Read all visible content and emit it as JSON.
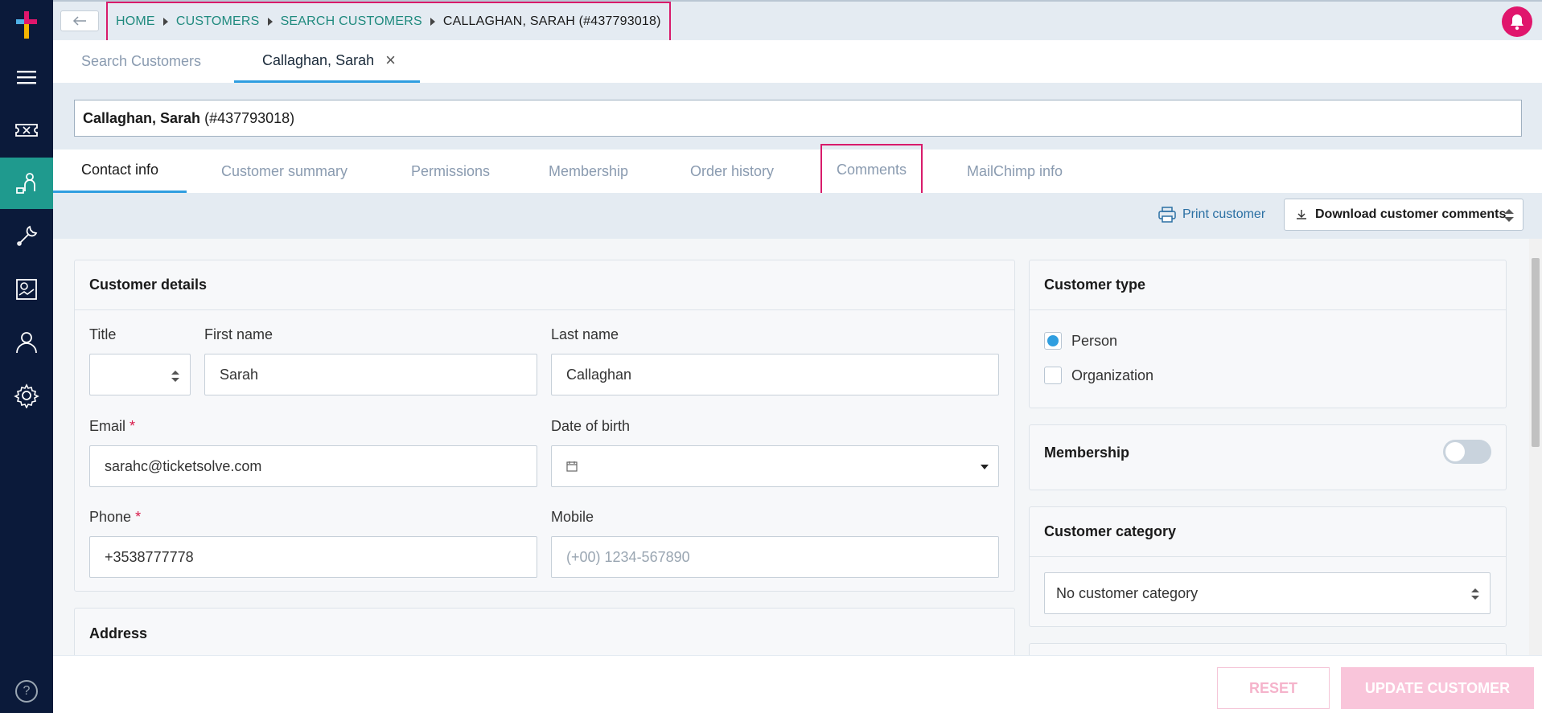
{
  "breadcrumb": {
    "home": "HOME",
    "customers": "CUSTOMERS",
    "search": "SEARCH CUSTOMERS",
    "current": "CALLAGHAN, SARAH (#437793018)"
  },
  "page_tabs": {
    "search": "Search Customers",
    "customer": "Callaghan, Sarah"
  },
  "customer_header": {
    "name": "Callaghan, Sarah",
    "id": "(#437793018)"
  },
  "section_tabs": [
    "Contact info",
    "Customer summary",
    "Permissions",
    "Membership",
    "Order history",
    "Comments",
    "MailChimp info"
  ],
  "actions": {
    "print": "Print customer",
    "download": "Download customer comments"
  },
  "customer_details": {
    "heading": "Customer details",
    "title_label": "Title",
    "title_value": "",
    "first_name_label": "First name",
    "first_name_value": "Sarah",
    "last_name_label": "Last name",
    "last_name_value": "Callaghan",
    "email_label": "Email",
    "email_value": "sarahc@ticketsolve.com",
    "dob_label": "Date of birth",
    "dob_value": "",
    "phone_label": "Phone",
    "phone_value": "+3538777778",
    "mobile_label": "Mobile",
    "mobile_placeholder": "(+00) 1234-567890",
    "required_mark": "*"
  },
  "address": {
    "heading": "Address"
  },
  "customer_type": {
    "heading": "Customer type",
    "options": [
      "Person",
      "Organization"
    ],
    "selected": "Person"
  },
  "membership": {
    "heading": "Membership",
    "enabled": false
  },
  "customer_category": {
    "heading": "Customer category",
    "value": "No customer category"
  },
  "footer": {
    "reset": "RESET",
    "update": "UPDATE CUSTOMER"
  },
  "help": "?",
  "colors": {
    "sidebar": "#0b1a3a",
    "accent_teal": "#1f9a8e",
    "accent_blue": "#2f9ee0",
    "brand_pink": "#e0166c",
    "highlight": "#d81b6b"
  },
  "icons": [
    "logo-icon",
    "menu-icon",
    "tickets-icon",
    "customers-icon",
    "tools-icon",
    "reports-icon",
    "user-icon",
    "settings-icon",
    "bell-icon",
    "print-icon",
    "download-icon",
    "calendar-icon",
    "close-icon",
    "back-arrow-icon",
    "help-icon"
  ]
}
